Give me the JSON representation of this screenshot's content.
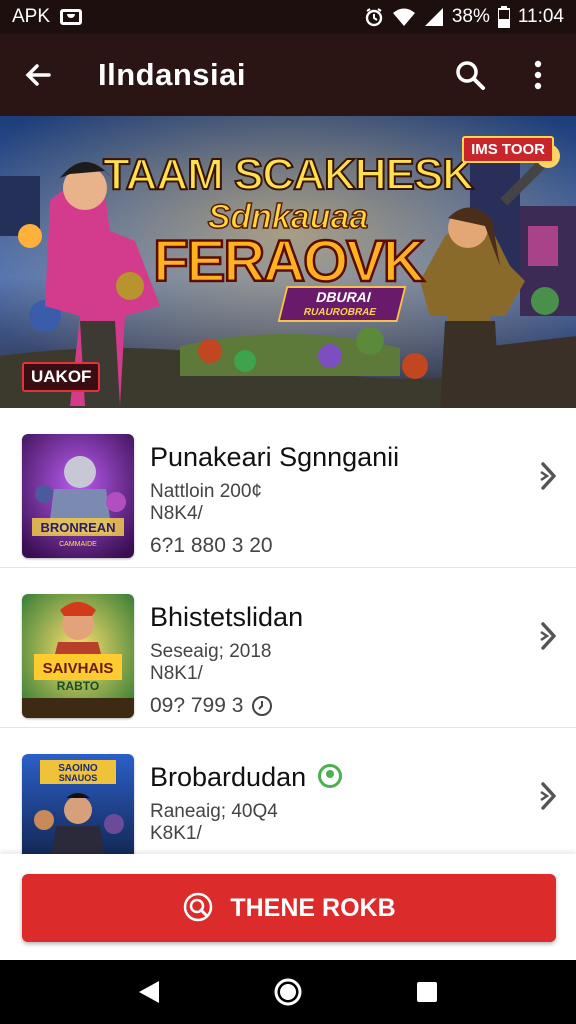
{
  "status_bar": {
    "left_label": "APK",
    "battery": "38%",
    "time": "11:04",
    "icons": [
      "notification-icon",
      "alarm-icon",
      "wifi-icon",
      "signal-icon",
      "battery-icon"
    ]
  },
  "app_bar": {
    "title": "Ilndansiai",
    "icons": [
      "back-arrow-icon",
      "search-icon",
      "more-vert-icon"
    ]
  },
  "banner": {
    "title_line1": "TAAM SCAKHESK",
    "title_line2": "Sdnkauaa",
    "title_line3": "FERAOVK",
    "ribbon_line1": "DBURAI",
    "ribbon_line2": "RUAUROBRAE",
    "corner_tag": "IMS TOOR",
    "bottom_label": "UAKOF"
  },
  "games": [
    {
      "name": "Punakeari Sgnnganii",
      "meta1": "Nattloin   200¢",
      "meta2": "N8K4/",
      "meta3": "6?1 880  3 20",
      "thumb_text": "BRONREAN",
      "thumb_sub": "CAMMAIDE",
      "verified": false,
      "accent": "#7b2cbf"
    },
    {
      "name": "Bhistetslidan",
      "meta1": "Seseaig;  2018",
      "meta2": "N8K1/",
      "meta3": "09? 799  3",
      "meta3_icon": "clock-icon",
      "thumb_text": "SAIVHAIS",
      "thumb_sub": "RABTO",
      "verified": false,
      "accent": "#2e8b3a"
    },
    {
      "name": "Brobardudan",
      "meta1": "Raneaig;  40Q4",
      "meta2": "K8K1/",
      "meta3": "",
      "thumb_text": "SAOINO",
      "thumb_sub": "SNAUOS",
      "verified": true,
      "accent": "#1c3d8c"
    }
  ],
  "primary_action": {
    "label": "THENE ROKB",
    "icon": "search-icon"
  },
  "nav": [
    "back-triangle-icon",
    "home-circle-icon",
    "recents-square-icon"
  ],
  "colors": {
    "app_bar": "#2a1414",
    "status_bar": "#1e0f0f",
    "primary": "#dc2b2b"
  }
}
